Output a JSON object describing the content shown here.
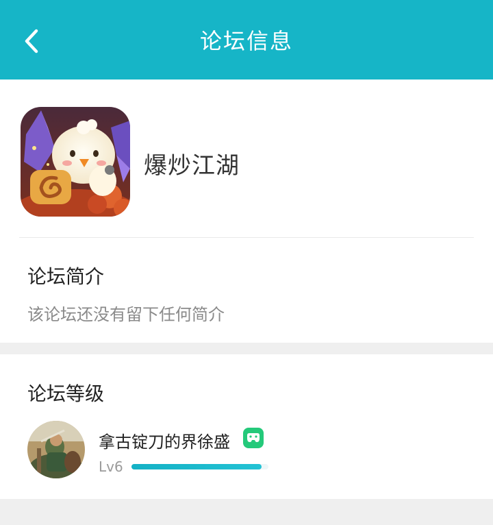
{
  "header": {
    "title": "论坛信息",
    "back_icon": "chevron-left-icon",
    "background": "#16b5c7"
  },
  "forum": {
    "name": "爆炒江湖",
    "icon": "game-app-icon"
  },
  "intro": {
    "title": "论坛简介",
    "text": "该论坛还没有留下任何简介"
  },
  "level": {
    "title": "论坛等级",
    "user_name": "拿古锭刀的界徐盛",
    "badge_icon": "game-controller-badge-icon",
    "lv_label": "Lv6",
    "progress": 0.95,
    "accent": "#16b5c7"
  }
}
